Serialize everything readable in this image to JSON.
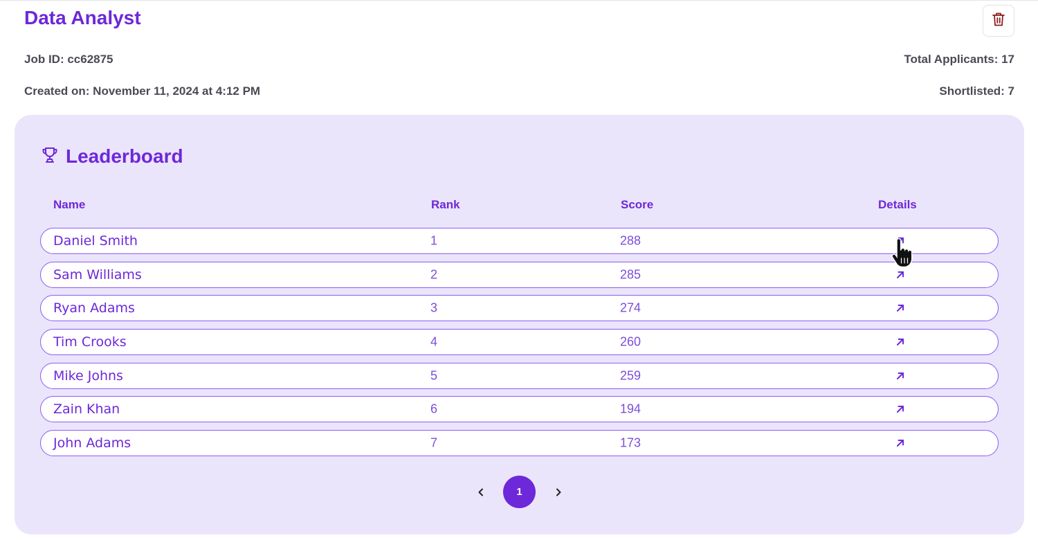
{
  "job": {
    "title": "Data Analyst",
    "job_id_text": "Job ID: cc62875",
    "created_text": "Created on: November 11, 2024 at 4:12 PM",
    "total_applicants_text": "Total Applicants: 17",
    "shortlisted_text": "Shortlisted: 7"
  },
  "leaderboard": {
    "title": "Leaderboard",
    "icon": "trophy-icon",
    "columns": {
      "name": "Name",
      "rank": "Rank",
      "score": "Score",
      "details": "Details"
    },
    "rows": [
      {
        "name": "Daniel Smith",
        "rank": "1",
        "score": "288"
      },
      {
        "name": "Sam Williams",
        "rank": "2",
        "score": "285"
      },
      {
        "name": "Ryan Adams",
        "rank": "3",
        "score": "274"
      },
      {
        "name": "Tim Crooks",
        "rank": "4",
        "score": "260"
      },
      {
        "name": "Mike Johns",
        "rank": "5",
        "score": "259"
      },
      {
        "name": "Zain Khan",
        "rank": "6",
        "score": "194"
      },
      {
        "name": "John Adams",
        "rank": "7",
        "score": "173"
      }
    ],
    "details_icon": "arrow-up-right-icon"
  },
  "pagination": {
    "current_page": "1",
    "prev_icon": "chevron-left-icon",
    "next_icon": "chevron-right-icon"
  },
  "colors": {
    "accent": "#6d28d9",
    "panel_bg": "#ebe5fb",
    "row_border": "#8b5cf6",
    "delete_icon": "#8b1d1d"
  }
}
